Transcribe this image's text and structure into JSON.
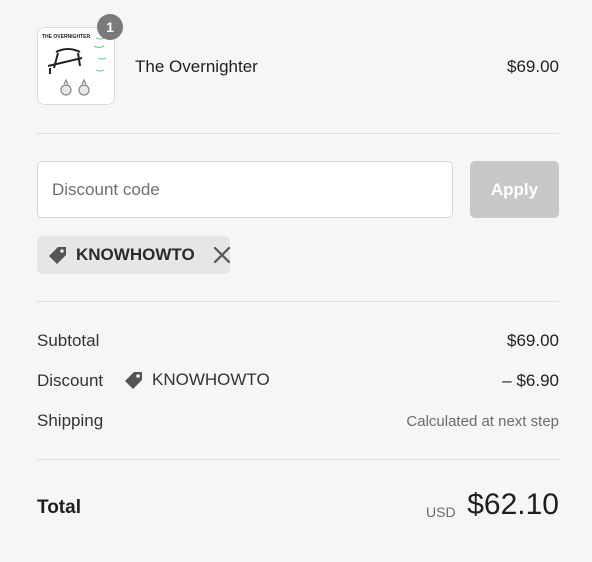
{
  "product": {
    "quantity": "1",
    "name": "The Overnighter",
    "price": "$69.00",
    "thumbnail_caption": "THE OVERNIGHTER"
  },
  "discount_form": {
    "placeholder": "Discount code",
    "apply_label": "Apply"
  },
  "applied_code": {
    "code": "KNOWHOWTO",
    "tag_icon": "tag-icon",
    "remove_icon": "close-icon"
  },
  "summary": {
    "subtotal_label": "Subtotal",
    "subtotal_value": "$69.00",
    "discount_label": "Discount",
    "discount_code": "KNOWHOWTO",
    "discount_prefix": "– ",
    "discount_value": "$6.90",
    "shipping_label": "Shipping",
    "shipping_value": "Calculated at next step"
  },
  "total": {
    "label": "Total",
    "currency": "USD",
    "amount": "$62.10"
  },
  "colors": {
    "background": "#f6f6f6",
    "apply_disabled": "#c8c8c8",
    "chip_bg": "#e6e6e6",
    "badge": "#7a7a7a"
  }
}
